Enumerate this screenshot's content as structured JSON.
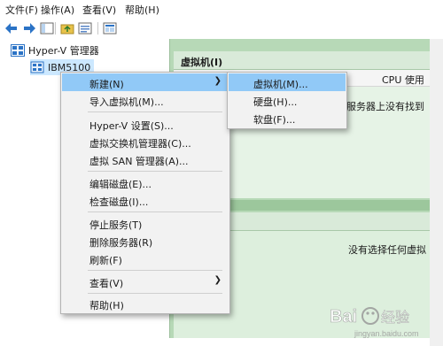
{
  "menubar": [
    {
      "label": "文件(F)"
    },
    {
      "label": "操作(A)"
    },
    {
      "label": "查看(V)"
    },
    {
      "label": "帮助(H)"
    }
  ],
  "toolbar": {
    "icons": [
      "back-arrow-icon",
      "forward-arrow-icon",
      "up-folder-icon",
      "show-tree-icon",
      "help-icon",
      "properties-icon"
    ]
  },
  "tree": {
    "root_label": "Hyper-V 管理器",
    "server_label": "IBM5100"
  },
  "vm_panel": {
    "title": "虚拟机(I)",
    "column_cpu": "CPU 使用",
    "empty_text": "服务器上没有找到"
  },
  "detail_panel": {
    "empty_text": "没有选择任何虚拟"
  },
  "context_menu": {
    "items": [
      {
        "label": "新建(N)",
        "submenu": true,
        "highlighted": true
      },
      {
        "label": "导入虚拟机(M)..."
      },
      {
        "label": "Hyper-V 设置(S)..."
      },
      {
        "label": "虚拟交换机管理器(C)..."
      },
      {
        "label": "虚拟 SAN 管理器(A)..."
      },
      {
        "label": "编辑磁盘(E)..."
      },
      {
        "label": "检查磁盘(I)..."
      },
      {
        "label": "停止服务(T)"
      },
      {
        "label": "删除服务器(R)"
      },
      {
        "label": "刷新(F)"
      },
      {
        "label": "查看(V)",
        "submenu": true
      },
      {
        "label": "帮助(H)"
      }
    ]
  },
  "submenu": {
    "items": [
      {
        "label": "虚拟机(M)...",
        "highlighted": true
      },
      {
        "label": "硬盘(H)..."
      },
      {
        "label": "软盘(F)..."
      }
    ]
  },
  "watermark": {
    "text": "Bai",
    "text2": "经验",
    "text3": "jingyan.baidu.com"
  },
  "colors": {
    "highlight": "#91c9f7",
    "panel_green": "#b7d9b7",
    "menu_bg": "#f2f2f2"
  }
}
